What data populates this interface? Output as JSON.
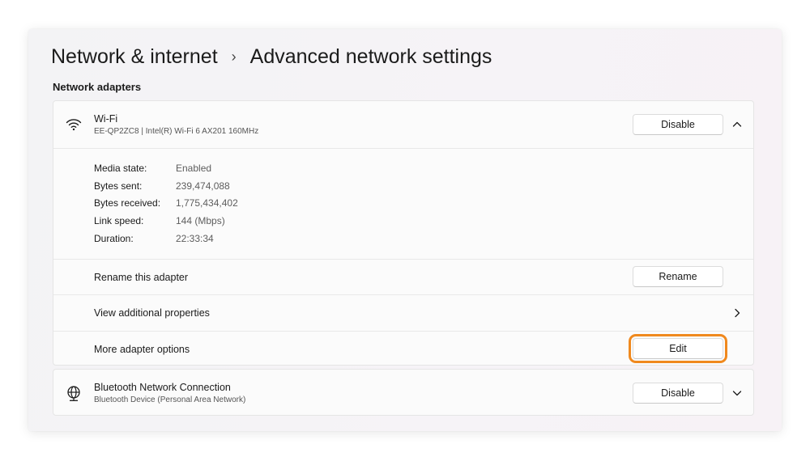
{
  "breadcrumb": {
    "parent": "Network & internet",
    "separator": "›",
    "current": "Advanced network settings"
  },
  "section_title": "Network adapters",
  "wifi": {
    "icon": "wifi-icon",
    "name": "Wi-Fi",
    "description": "EE-QP2ZC8 | Intel(R) Wi-Fi 6 AX201 160MHz",
    "disable_label": "Disable",
    "expanded": true,
    "details": [
      {
        "label": "Media state:",
        "value": "Enabled"
      },
      {
        "label": "Bytes sent:",
        "value": "239,474,088"
      },
      {
        "label": "Bytes received:",
        "value": "1,775,434,402"
      },
      {
        "label": "Link speed:",
        "value": "144 (Mbps)"
      },
      {
        "label": "Duration:",
        "value": "22:33:34"
      }
    ],
    "rename_label": "Rename this adapter",
    "rename_button": "Rename",
    "view_properties_label": "View additional properties",
    "more_options_label": "More adapter options",
    "edit_button": "Edit"
  },
  "bluetooth": {
    "icon": "globe-network-icon",
    "name": "Bluetooth Network Connection",
    "description": "Bluetooth Device (Personal Area Network)",
    "disable_label": "Disable",
    "expanded": false
  },
  "colors": {
    "highlight": "#f0891e",
    "background": "#f3f3f5",
    "card": "#fbfbfb"
  }
}
